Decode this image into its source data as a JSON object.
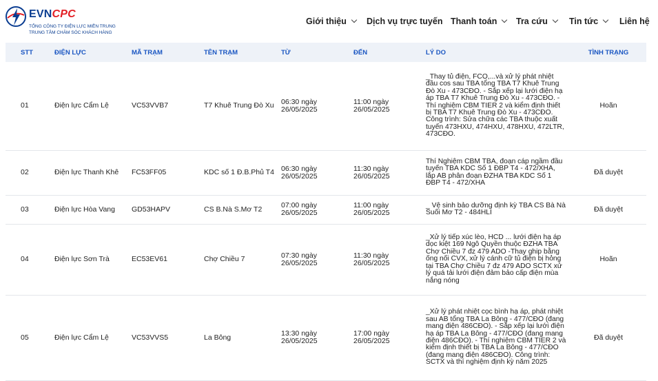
{
  "brand": {
    "name_a": "EVN",
    "name_b": "CPC",
    "sub1": "TỔNG CÔNG TY ĐIỆN LỰC MIỀN TRUNG",
    "sub2": "TRUNG TÂM CHĂM SÓC KHÁCH HÀNG",
    "colors": {
      "blue": "#0a3d91",
      "red": "#e31e24"
    }
  },
  "nav": [
    {
      "label": "Giới thiệu",
      "dropdown": true
    },
    {
      "label": "Dịch vụ trực tuyến",
      "dropdown": false
    },
    {
      "label": "Thanh toán",
      "dropdown": true
    },
    {
      "label": "Tra cứu",
      "dropdown": true
    },
    {
      "label": "Tin tức",
      "dropdown": true
    },
    {
      "label": "Liên hệ",
      "dropdown": false
    }
  ],
  "table": {
    "headers": [
      "STT",
      "ĐIỆN LỰC",
      "MÃ TRẠM",
      "TÊN TRẠM",
      "TỪ",
      "ĐẾN",
      "LÝ DO",
      "TÌNH TRẠNG"
    ],
    "rows": [
      {
        "stt": "01",
        "dien_luc": "Điện lực Cẩm Lệ",
        "ma_tram": "VC53VVB7",
        "ten_tram": "T7 Khuê Trung Đò Xu",
        "tu": "06:30 ngày 26/05/2025",
        "den": "11:00 ngày 26/05/2025",
        "ly_do": "_Thay tủ điện, FCO,...và xử lý phát nhiệt đầu cos sau TBA tổng TBA T7 Khuê Trung Đò Xu - 473CĐO. - Sắp xếp lại lưới điện hạ áp TBA T7 Khuê Trung Đò Xu - 473CĐO. - Thí nghiệm CBM TIER 2 và kiểm định thiết bị TBA T7 Khuê Trung Đò Xu - 473CĐO. Công trình: Sửa chữa các TBA thuộc xuất tuyến 473HXU, 474HXU, 478HXU, 472LTR, 473CĐO.",
        "tinh_trang": "Hoãn"
      },
      {
        "stt": "02",
        "dien_luc": "Điện lực Thanh Khê",
        "ma_tram": "FC53FF05",
        "ten_tram": "KDC số 1 Đ.B.Phủ T4",
        "tu": "06:30 ngày 26/05/2025",
        "den": "11:30 ngày 26/05/2025",
        "ly_do": "Thí Nghiệm CBM TBA, đoạn cáp ngầm đầu tuyến TBA KDC Số 1 ĐBP T4 - 472/XHA, lắp AB phân đoạn ĐZHA TBA KDC Số 1 ĐBP T4 - 472/XHA",
        "tinh_trang": "Đã duyệt"
      },
      {
        "stt": "03",
        "dien_luc": "Điện lực Hòa Vang",
        "ma_tram": "GD53HAPV",
        "ten_tram": "CS B.Nà S.Mơ T2",
        "tu": "07:00 ngày 26/05/2025",
        "den": "11:00 ngày 26/05/2025",
        "ly_do": "_ Vệ sinh bảo dưỡng định kỳ TBA CS Bà Nà Suối Mơ T2 - 484HLI",
        "tinh_trang": "Đã duyệt"
      },
      {
        "stt": "04",
        "dien_luc": "Điện lực Sơn Trà",
        "ma_tram": "EC53EV61",
        "ten_tram": "Chợ Chiều 7",
        "tu": "07:30 ngày 26/05/2025",
        "den": "11:30 ngày 26/05/2025",
        "ly_do": "_Xử lý tiếp xúc lèo, HCD ... lưới điện hạ áp dọc kiệt 169 Ngô Quyền thuộc ĐZHA TBA Chợ Chiều 7 đz 479 ADO -Thay ghip bằng ống nối CVX, xử lý cánh cữ tủ điện bị hỏng tại TBA Chợ Chiều 7 đz 479 ADO SCTX xử lý quá tải lưới điện đảm bảo cấp điện mùa nắng nóng",
        "tinh_trang": "Hoãn"
      },
      {
        "stt": "05",
        "dien_luc": "Điện lực Cẩm Lệ",
        "ma_tram": "VC53VVS5",
        "ten_tram": "La Bông",
        "tu": "13:30 ngày 26/05/2025",
        "den": "17:00 ngày 26/05/2025",
        "ly_do": "_Xử lý phát nhiệt cọc bình hạ áp, phát nhiệt sau AB tổng TBA La Bông - 477/CĐO (đang mang điện 486CĐO). - Sắp xếp lại lưới điện hạ áp TBA La Bông - 477/CĐO (đang mang điện 486CĐO). - Thí nghiệm CBM TIER 2 và kiểm định thiết bị TBA La Bông - 477/CĐO (đang mang điện 486CĐO). Công trình: SCTX và thí nghiệm định kỳ năm 2025",
        "tinh_trang": "Đã duyệt"
      }
    ]
  }
}
